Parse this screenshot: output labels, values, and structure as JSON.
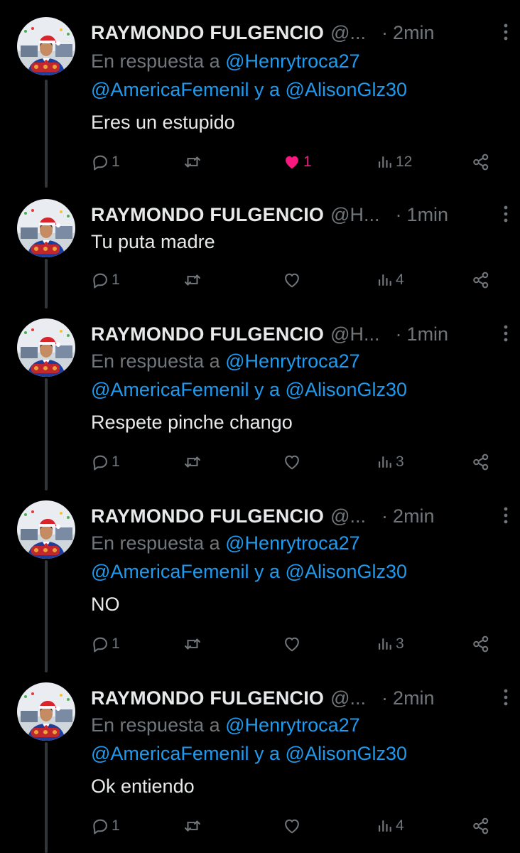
{
  "colors": {
    "background": "#000000",
    "text": "#e7e9ea",
    "secondary": "#71767b",
    "mention": "#1d9bf0",
    "like_active": "#f91880",
    "thread_line": "#333639"
  },
  "tweets": [
    {
      "name": "RAYMONDO FULGENCIO",
      "handle": "@...",
      "separator": "·",
      "time": "2min",
      "reply_prefix": "En respuesta a",
      "reply_to_1": "@Henrytroca27",
      "reply_to_2": "@AmericaFemenil",
      "reply_join": "y a",
      "reply_to_3": "@AlisonGlz30",
      "text": "Eres un estupido",
      "replies": "1",
      "retweets": "",
      "likes": "1",
      "liked": true,
      "views": "12",
      "more_icon": "more-vertical-icon",
      "icons": [
        "reply-icon",
        "retweet-icon",
        "like-icon",
        "views-icon",
        "share-icon"
      ]
    },
    {
      "name": "RAYMONDO FULGENCIO",
      "handle": "@H...",
      "separator": "·",
      "time": "1min",
      "text": "Tu puta madre",
      "replies": "1",
      "retweets": "",
      "likes": "",
      "liked": false,
      "views": "4"
    },
    {
      "name": "RAYMONDO FULGENCIO",
      "handle": "@H...",
      "separator": "·",
      "time": "1min",
      "reply_prefix": "En respuesta a",
      "reply_to_1": "@Henrytroca27",
      "reply_to_2": "@AmericaFemenil",
      "reply_join": "y a",
      "reply_to_3": "@AlisonGlz30",
      "text": "Respete pinche chango",
      "replies": "1",
      "retweets": "",
      "likes": "",
      "liked": false,
      "views": "3"
    },
    {
      "name": "RAYMONDO FULGENCIO",
      "handle": "@...",
      "separator": "·",
      "time": "2min",
      "reply_prefix": "En respuesta a",
      "reply_to_1": "@Henrytroca27",
      "reply_to_2": "@AmericaFemenil",
      "reply_join": "y a",
      "reply_to_3": "@AlisonGlz30",
      "text": "NO",
      "replies": "1",
      "retweets": "",
      "likes": "",
      "liked": false,
      "views": "3"
    },
    {
      "name": "RAYMONDO FULGENCIO",
      "handle": "@...",
      "separator": "·",
      "time": "2min",
      "reply_prefix": "En respuesta a",
      "reply_to_1": "@Henrytroca27",
      "reply_to_2": "@AmericaFemenil",
      "reply_join": "y a",
      "reply_to_3": "@AlisonGlz30",
      "text": "Ok entiendo",
      "replies": "1",
      "retweets": "",
      "likes": "",
      "liked": false,
      "views": "4"
    }
  ]
}
